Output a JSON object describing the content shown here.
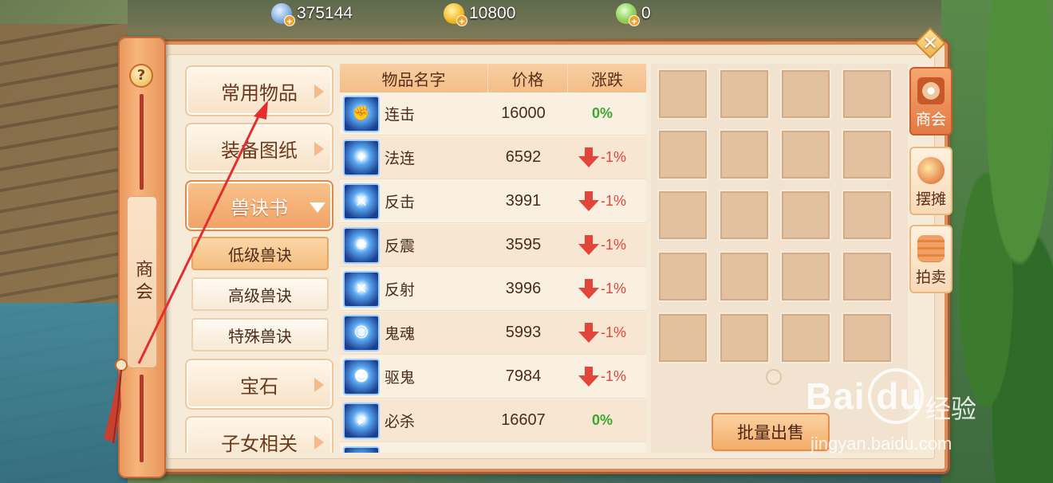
{
  "currencies": [
    {
      "icon": "silver-coin-icon",
      "value": "375144"
    },
    {
      "icon": "gold-ingot-icon",
      "value": "10800"
    },
    {
      "icon": "jade-coin-icon",
      "value": "0"
    }
  ],
  "side_scroll": {
    "help": "?",
    "label": "商会"
  },
  "menu": {
    "common": "常用物品",
    "equipment": "装备图纸",
    "beast_books": "兽诀书",
    "sub_low": "低级兽诀",
    "sub_high": "高级兽诀",
    "sub_special": "特殊兽诀",
    "gems": "宝石",
    "children": "子女相关"
  },
  "table": {
    "headers": {
      "name": "物品名字",
      "price": "价格",
      "change": "涨跌"
    },
    "rows": [
      {
        "name": "连击",
        "price": "16000",
        "change": "0%",
        "trend": "flat"
      },
      {
        "name": "法连",
        "price": "6592",
        "change": "-1%",
        "trend": "down"
      },
      {
        "name": "反击",
        "price": "3991",
        "change": "-1%",
        "trend": "down"
      },
      {
        "name": "反震",
        "price": "3595",
        "change": "-1%",
        "trend": "down"
      },
      {
        "name": "反射",
        "price": "3996",
        "change": "-1%",
        "trend": "down"
      },
      {
        "name": "鬼魂",
        "price": "5993",
        "change": "-1%",
        "trend": "down"
      },
      {
        "name": "驱鬼",
        "price": "7984",
        "change": "-1%",
        "trend": "down"
      },
      {
        "name": "必杀",
        "price": "16607",
        "change": "0%",
        "trend": "flat"
      }
    ]
  },
  "batch_sell": "批量出售",
  "side_tabs": {
    "shop": "商会",
    "stall": "摆摊",
    "auction": "拍卖"
  },
  "watermark": {
    "logo": "Bai du",
    "text": "经验",
    "url": "jingyan.baidu.com"
  },
  "colors": {
    "accent": "#f0a266",
    "trend_down": "#e2463a",
    "trend_flat": "#3ba72e",
    "annotation": "#e52d2d"
  }
}
